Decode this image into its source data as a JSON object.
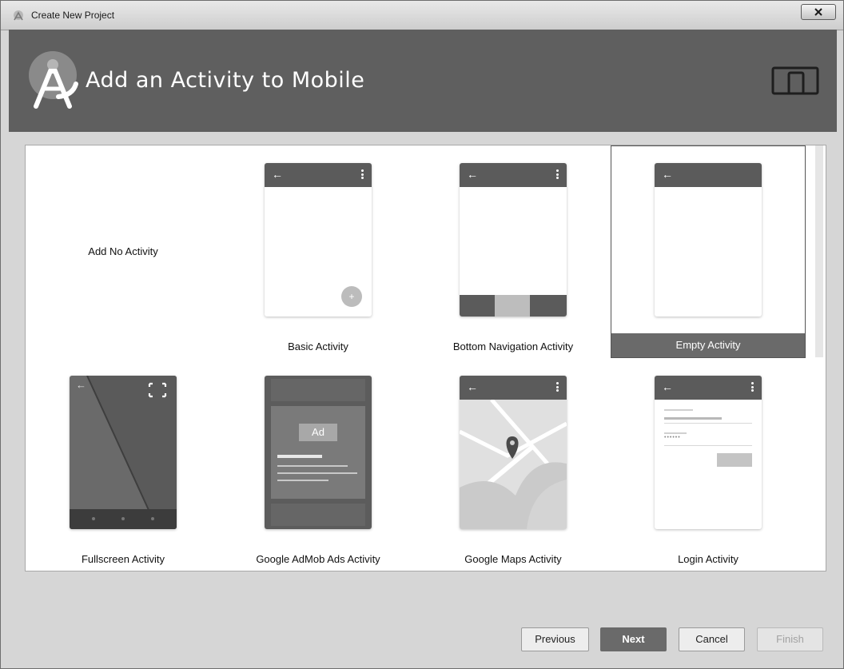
{
  "window": {
    "title": "Create New Project",
    "close_symbol": "x"
  },
  "header": {
    "title": "Add an Activity to Mobile",
    "logo_icon": "android-studio-icon",
    "device_icon": "tablet-phone-icon"
  },
  "gallery": {
    "no_activity_label": "Add No Activity",
    "selected": "Empty Activity",
    "tiles": [
      {
        "label": "Basic Activity"
      },
      {
        "label": "Bottom Navigation Activity"
      },
      {
        "label": "Empty Activity"
      },
      {
        "label": "Fullscreen Activity"
      },
      {
        "label": "Google AdMob Ads Activity",
        "ad_badge": "Ad"
      },
      {
        "label": "Google Maps Activity"
      },
      {
        "label": "Login Activity",
        "password_mask": "••••••"
      }
    ]
  },
  "buttons": {
    "previous": "Previous",
    "next": "Next",
    "cancel": "Cancel",
    "finish": "Finish"
  },
  "colors": {
    "header_bg": "#5f5f5f",
    "selected_label_bg": "#6a6a6a",
    "next_button_bg": "#6a6a6a"
  }
}
